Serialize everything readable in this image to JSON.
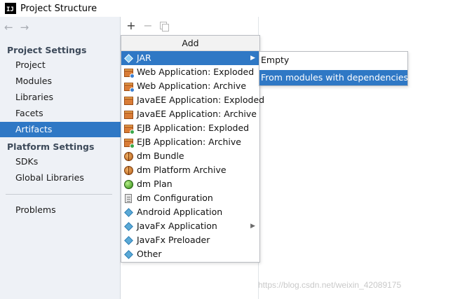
{
  "window": {
    "app_icon_text": "IJ",
    "title": "Project Structure"
  },
  "nav": {
    "back_glyph": "←",
    "forward_glyph": "→"
  },
  "sidebar": {
    "project_settings_header": "Project Settings",
    "project_items": [
      {
        "label": "Project",
        "selected": false
      },
      {
        "label": "Modules",
        "selected": false
      },
      {
        "label": "Libraries",
        "selected": false
      },
      {
        "label": "Facets",
        "selected": false
      },
      {
        "label": "Artifacts",
        "selected": true
      }
    ],
    "platform_settings_header": "Platform Settings",
    "platform_items": [
      {
        "label": "SDKs"
      },
      {
        "label": "Global Libraries"
      }
    ],
    "problems_label": "Problems"
  },
  "toolbar": {
    "add_glyph": "+",
    "remove_glyph": "−"
  },
  "add_menu": {
    "header": "Add",
    "items": [
      {
        "label": "JAR",
        "icon": "diamond-icon",
        "highlighted": true,
        "submenu": true
      },
      {
        "label": "Web Application: Exploded",
        "icon": "web-app-icon"
      },
      {
        "label": "Web Application: Archive",
        "icon": "web-app-icon"
      },
      {
        "label": "JavaEE Application: Exploded",
        "icon": "javaee-app-icon"
      },
      {
        "label": "JavaEE Application: Archive",
        "icon": "javaee-app-icon"
      },
      {
        "label": "EJB Application: Exploded",
        "icon": "ejb-app-icon"
      },
      {
        "label": "EJB Application: Archive",
        "icon": "ejb-app-icon"
      },
      {
        "label": "dm Bundle",
        "icon": "bundle-icon"
      },
      {
        "label": "dm Platform Archive",
        "icon": "bundle-icon"
      },
      {
        "label": "dm Plan",
        "icon": "plan-icon"
      },
      {
        "label": "dm Configuration",
        "icon": "config-icon"
      },
      {
        "label": "Android Application",
        "icon": "diamond-icon"
      },
      {
        "label": "JavaFx Application",
        "icon": "diamond-icon",
        "submenu": true
      },
      {
        "label": "JavaFx Preloader",
        "icon": "diamond-icon"
      },
      {
        "label": "Other",
        "icon": "diamond-icon"
      }
    ]
  },
  "jar_submenu": {
    "items": [
      {
        "label": "Empty",
        "highlighted": false
      },
      {
        "label": "From modules with dependencies...",
        "highlighted": true
      }
    ]
  },
  "watermark": "https://blog.csdn.net/weixin_42089175",
  "colors": {
    "selection": "#2f78c5",
    "sidebar_bg": "#eef1f6"
  }
}
